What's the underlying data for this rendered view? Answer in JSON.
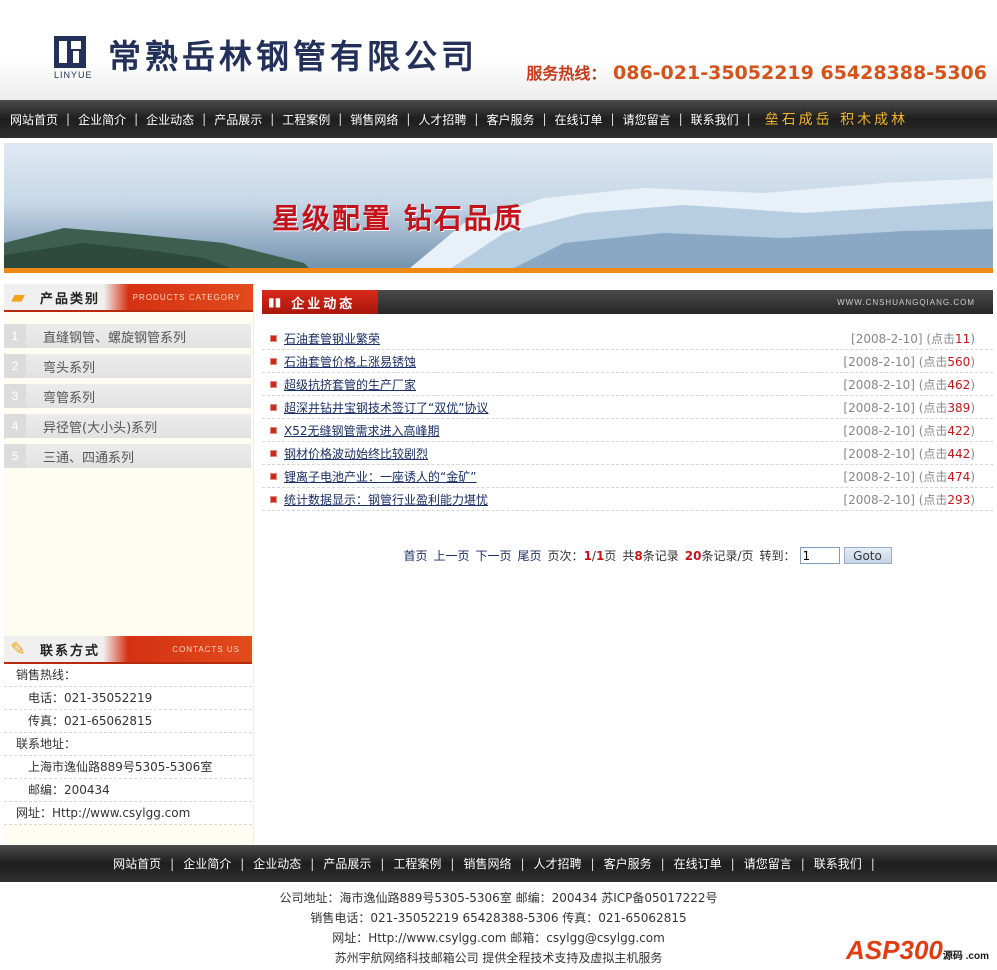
{
  "header": {
    "logo_sub": "LINYUE",
    "company_name": "常熟岳林钢管有限公司",
    "hotline_label": "服务热线：",
    "hotline_numbers": "086-021-35052219  65428388-5306"
  },
  "nav": {
    "items": [
      "网站首页",
      "企业简介",
      "企业动态",
      "产品展示",
      "工程案例",
      "销售网络",
      "人才招聘",
      "客户服务",
      "在线订单",
      "请您留言",
      "联系我们"
    ],
    "slogan": "垒石成岳 积木成林"
  },
  "banner": {
    "slogan": "星级配置  钻石品质"
  },
  "sidebar": {
    "category_title": "产品类别",
    "category_en": "PRODUCTS CATEGORY",
    "categories": [
      {
        "num": "1",
        "label": "直缝钢管、螺旋钢管系列"
      },
      {
        "num": "2",
        "label": "弯头系列"
      },
      {
        "num": "3",
        "label": "弯管系列"
      },
      {
        "num": "4",
        "label": "异径管(大小头)系列"
      },
      {
        "num": "5",
        "label": "三通、四通系列"
      }
    ],
    "contact_title": "联系方式",
    "contact_en": "CONTACTS US",
    "contact_rows": [
      {
        "text": "销售热线：",
        "indent": 0
      },
      {
        "text": "电话：021-35052219",
        "indent": 1
      },
      {
        "text": "传真：021-65062815",
        "indent": 1
      },
      {
        "text": "联系地址：",
        "indent": 0
      },
      {
        "text": "上海市逸仙路889号5305-5306室",
        "indent": 1
      },
      {
        "text": "邮编：200434",
        "indent": 1
      },
      {
        "text": "网址：Http://www.csylgg.com",
        "indent": 0
      }
    ]
  },
  "main": {
    "section_title": "企业动态",
    "site": "WWW.CNSHUANGQIANG.COM",
    "news": [
      {
        "title": "石油套管钢业繁荣",
        "date": "[2008-2-10]",
        "hits": "11"
      },
      {
        "title": "石油套管价格上涨易锈蚀",
        "date": "[2008-2-10]",
        "hits": "560"
      },
      {
        "title": "超级抗挤套管的生产厂家",
        "date": "[2008-2-10]",
        "hits": "462"
      },
      {
        "title": "超深井钻井宝钢技术签订了“双优”协议",
        "date": "[2008-2-10]",
        "hits": "389"
      },
      {
        "title": "X52无缝钢管需求进入高峰期",
        "date": "[2008-2-10]",
        "hits": "422"
      },
      {
        "title": "钢材价格波动始终比较剧烈",
        "date": "[2008-2-10]",
        "hits": "442"
      },
      {
        "title": "锂离子电池产业：一座诱人的“金矿”",
        "date": "[2008-2-10]",
        "hits": "474"
      },
      {
        "title": "统计数据显示：钢管行业盈利能力堪忧",
        "date": "[2008-2-10]",
        "hits": "293"
      }
    ],
    "hits_prefix": "(点击",
    "hits_suffix": ")",
    "pager": {
      "first": "首页",
      "prev": "上一页",
      "next": "下一页",
      "last": "尾页",
      "page_label": "页次：",
      "current": "1",
      "total_pages": "1",
      "page_unit": "页",
      "total_prefix": "共",
      "total_records": "8",
      "total_suffix": "条记录",
      "per_page": "20",
      "per_page_suffix": "条记录/页",
      "goto_label": "转到：",
      "goto_value": "1",
      "goto_button": "Goto"
    }
  },
  "footer": {
    "nav": [
      "网站首页",
      "企业简介",
      "企业动态",
      "产品展示",
      "工程案例",
      "销售网络",
      "人才招聘",
      "客户服务",
      "在线订单",
      "请您留言",
      "联系我们"
    ],
    "lines": [
      "公司地址：海市逸仙路889号5305-5306室   邮编：200434   苏ICP备05017222号",
      "销售电话：021-35052219 65428388-5306 传真：021-65062815",
      "网址：Http://www.csylgg.com   邮箱：csylgg@csylgg.com",
      "苏州宇航网络科技邮箱公司      提供全程技术支持及虚拟主机服务"
    ],
    "watermark": "ASP300",
    "watermark_sub": "源码 .com"
  }
}
